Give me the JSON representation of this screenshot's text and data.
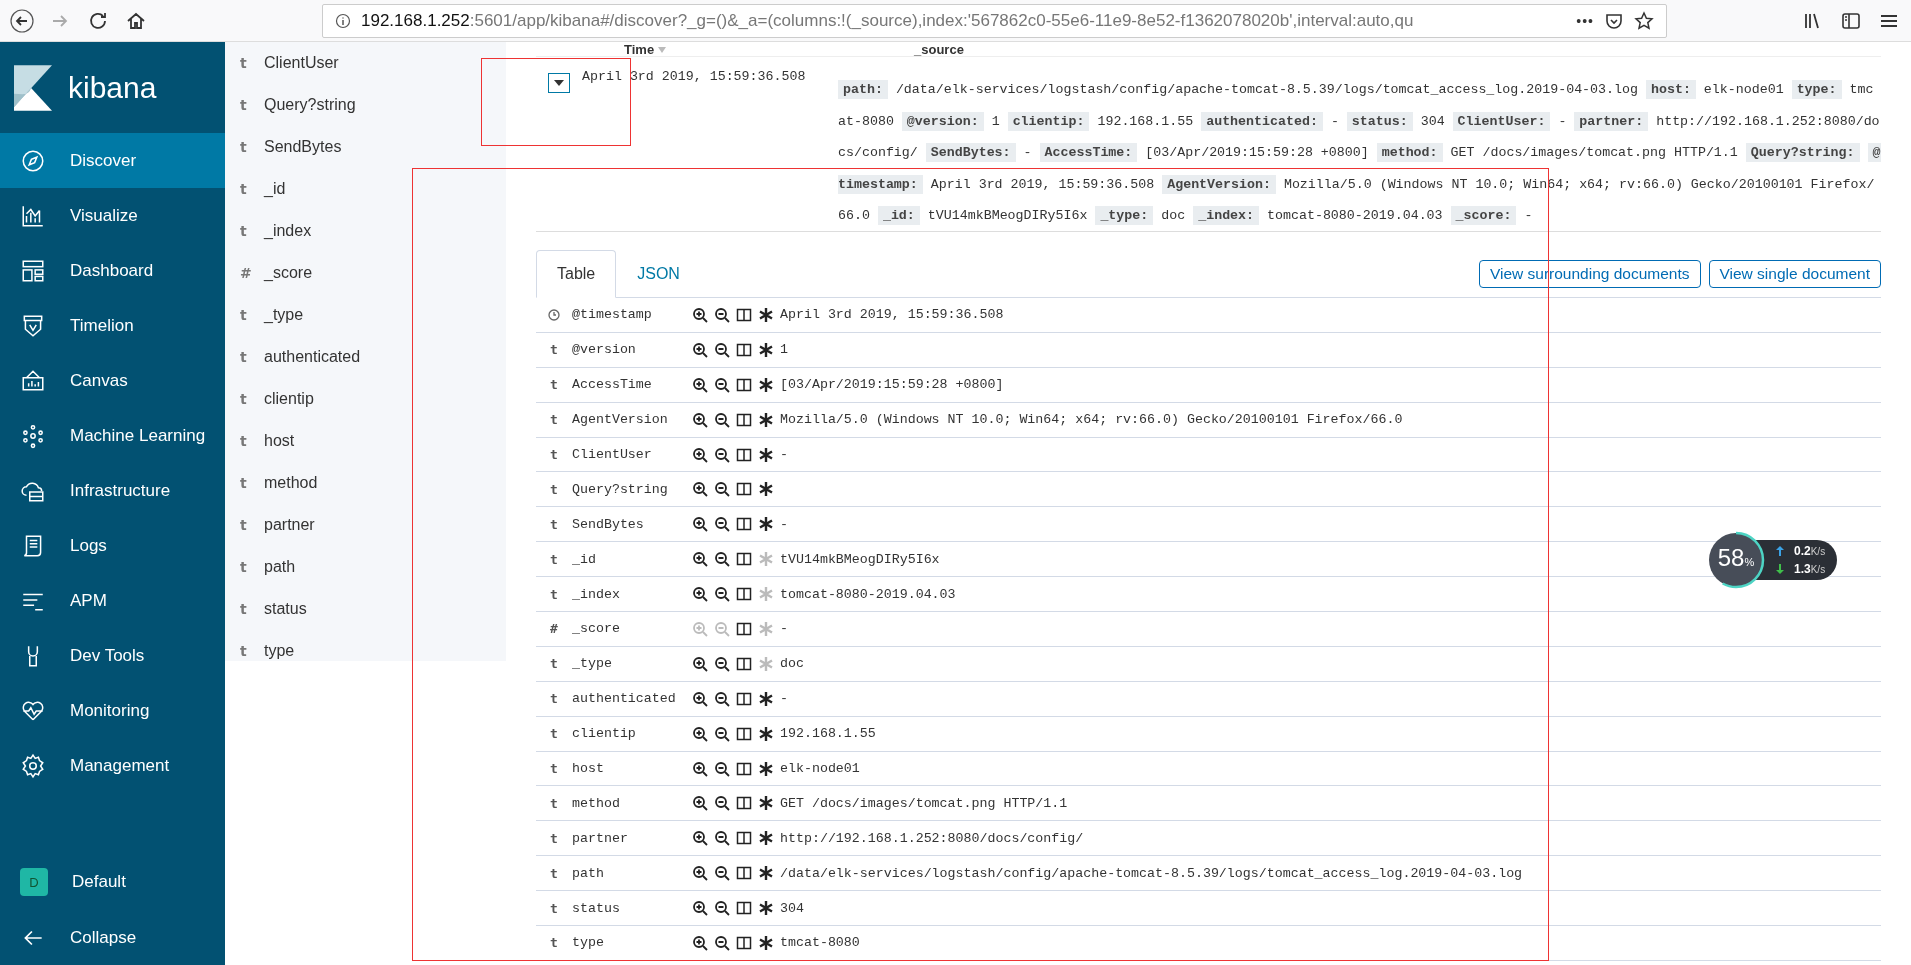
{
  "browser": {
    "url_host": "192.168.1.252",
    "url_rest": ":5601/app/kibana#/discover?_g=()&_a=(columns:!(_source),index:'567862c0-55e6-11e9-8e52-f1362078020b',interval:auto,qu",
    "more": "•••",
    "forward_disabled": true
  },
  "sidebar": {
    "brand": "kibana",
    "items": [
      {
        "label": "Discover",
        "selected": true
      },
      {
        "label": "Visualize",
        "selected": false
      },
      {
        "label": "Dashboard",
        "selected": false
      },
      {
        "label": "Timelion",
        "selected": false
      },
      {
        "label": "Canvas",
        "selected": false
      },
      {
        "label": "Machine Learning",
        "selected": false
      },
      {
        "label": "Infrastructure",
        "selected": false
      },
      {
        "label": "Logs",
        "selected": false
      },
      {
        "label": "APM",
        "selected": false
      },
      {
        "label": "Dev Tools",
        "selected": false
      },
      {
        "label": "Monitoring",
        "selected": false
      },
      {
        "label": "Management",
        "selected": false
      }
    ],
    "space": {
      "initial": "D",
      "label": "Default"
    },
    "collapse": "Collapse"
  },
  "field_list": [
    {
      "type": "t",
      "name": "ClientUser"
    },
    {
      "type": "t",
      "name": "Query?string"
    },
    {
      "type": "t",
      "name": "SendBytes"
    },
    {
      "type": "t",
      "name": "_id"
    },
    {
      "type": "t",
      "name": "_index"
    },
    {
      "type": "#",
      "name": "_score"
    },
    {
      "type": "t",
      "name": "_type"
    },
    {
      "type": "t",
      "name": "authenticated"
    },
    {
      "type": "t",
      "name": "clientip"
    },
    {
      "type": "t",
      "name": "host"
    },
    {
      "type": "t",
      "name": "method"
    },
    {
      "type": "t",
      "name": "partner"
    },
    {
      "type": "t",
      "name": "path"
    },
    {
      "type": "t",
      "name": "status"
    },
    {
      "type": "t",
      "name": "type"
    }
  ],
  "results": {
    "columns": [
      "Time",
      "_source"
    ],
    "document": {
      "expanded": true,
      "time": "April 3rd 2019, 15:59:36.508",
      "source": [
        {
          "key": "path:",
          "value": "/data/elk-services/logstash/config/apache-tomcat-8.5.39/logs/tomcat_access_log.2019-04-03.log"
        },
        {
          "key": "host:",
          "value": "elk-node01"
        },
        {
          "key": "type:",
          "value": "tmcat-8080"
        },
        {
          "key": "@version:",
          "value": "1"
        },
        {
          "key": "clientip:",
          "value": "192.168.1.55"
        },
        {
          "key": "authenticated:",
          "value": "-"
        },
        {
          "key": "status:",
          "value": "304"
        },
        {
          "key": "ClientUser:",
          "value": "-"
        },
        {
          "key": "partner:",
          "value": "http://192.168.1.252:8080/docs/config/"
        },
        {
          "key": "SendBytes:",
          "value": "-"
        },
        {
          "key": "AccessTime:",
          "value": "[03/Apr/2019:15:59:28 +0800]"
        },
        {
          "key": "method:",
          "value": "GET /docs/images/tomcat.png HTTP/1.1"
        },
        {
          "key": "Query?string:"
        },
        {
          "key": "@timestamp:",
          "value": "April 3rd 2019, 15:59:36.508"
        },
        {
          "key": "AgentVersion:",
          "value": "Mozilla/5.0 (Windows NT 10.0; Win64; x64; rv:66.0) Gecko/20100101 Firefox/66.0"
        },
        {
          "key": "_id:",
          "value": "tVU14mkBMeogDIRy5I6x"
        },
        {
          "key": "_type:",
          "value": "doc"
        },
        {
          "key": "_index:",
          "value": "tomcat-8080-2019.04.03"
        },
        {
          "key": "_score:",
          "value": "-"
        }
      ]
    }
  },
  "detail": {
    "tabs": [
      {
        "label": "Table",
        "selected": true
      },
      {
        "label": "JSON",
        "selected": false
      }
    ],
    "actions": [
      "View surrounding documents",
      "View single document"
    ],
    "rows": [
      {
        "kind": "date",
        "name": "@timestamp",
        "value": "April 3rd 2019, 15:59:36.508",
        "filters_enabled": true,
        "exists_enabled": true
      },
      {
        "type": "t",
        "name": "@version",
        "value": "1",
        "filters_enabled": true,
        "exists_enabled": true
      },
      {
        "type": "t",
        "name": "AccessTime",
        "value": "[03/Apr/2019:15:59:28 +0800]",
        "filters_enabled": true,
        "exists_enabled": true
      },
      {
        "type": "t",
        "name": "AgentVersion",
        "value": "Mozilla/5.0 (Windows NT 10.0; Win64; x64; rv:66.0) Gecko/20100101 Firefox/66.0",
        "filters_enabled": true,
        "exists_enabled": true
      },
      {
        "type": "t",
        "name": "ClientUser",
        "value": "-",
        "filters_enabled": true,
        "exists_enabled": true
      },
      {
        "type": "t",
        "name": "Query?string",
        "filters_enabled": true,
        "exists_enabled": true
      },
      {
        "type": "t",
        "name": "SendBytes",
        "value": "-",
        "filters_enabled": true,
        "exists_enabled": true
      },
      {
        "type": "t",
        "name": "_id",
        "value": "tVU14mkBMeogDIRy5I6x",
        "filters_enabled": true,
        "exists_enabled": false
      },
      {
        "type": "t",
        "name": "_index",
        "value": "tomcat-8080-2019.04.03",
        "filters_enabled": true,
        "exists_enabled": false
      },
      {
        "type": "#",
        "name": "_score",
        "value": "-",
        "filters_enabled": false,
        "exists_enabled": false
      },
      {
        "type": "t",
        "name": "_type",
        "value": "doc",
        "filters_enabled": true,
        "exists_enabled": false
      },
      {
        "type": "t",
        "name": "authenticated",
        "value": "-",
        "filters_enabled": true,
        "exists_enabled": true
      },
      {
        "type": "t",
        "name": "clientip",
        "value": "192.168.1.55",
        "filters_enabled": true,
        "exists_enabled": true
      },
      {
        "type": "t",
        "name": "host",
        "value": "elk-node01",
        "filters_enabled": true,
        "exists_enabled": true
      },
      {
        "type": "t",
        "name": "method",
        "value": "GET /docs/images/tomcat.png HTTP/1.1",
        "filters_enabled": true,
        "exists_enabled": true
      },
      {
        "type": "t",
        "name": "partner",
        "value": "http://192.168.1.252:8080/docs/config/",
        "filters_enabled": true,
        "exists_enabled": true
      },
      {
        "type": "t",
        "name": "path",
        "value": "/data/elk-services/logstash/config/apache-tomcat-8.5.39/logs/tomcat_access_log.2019-04-03.log",
        "filters_enabled": true,
        "exists_enabled": true
      },
      {
        "type": "t",
        "name": "status",
        "value": "304",
        "filters_enabled": true,
        "exists_enabled": true
      },
      {
        "type": "t",
        "name": "type",
        "value": "tmcat-8080",
        "filters_enabled": true,
        "exists_enabled": true
      }
    ]
  },
  "network_widget": {
    "percent": "58",
    "percent_unit": "%",
    "upload": {
      "value": "0.2",
      "unit": "K/s"
    },
    "download": {
      "value": "1.3",
      "unit": "K/s"
    }
  }
}
